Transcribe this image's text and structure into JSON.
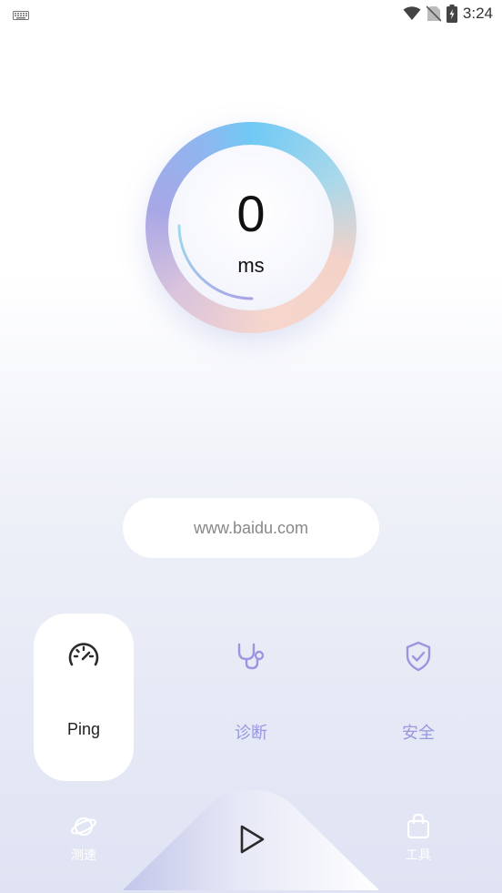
{
  "status_bar": {
    "time": "3:24",
    "icons": [
      "keyboard-icon",
      "wifi-icon",
      "no-sim-icon",
      "battery-charging-icon"
    ]
  },
  "gauge": {
    "value": "0",
    "unit": "ms"
  },
  "url_field": {
    "value": "www.baidu.com"
  },
  "modes": [
    {
      "label": "Ping",
      "icon": "speedometer-icon",
      "active": true
    },
    {
      "label": "诊断",
      "icon": "stethoscope-icon",
      "active": false
    },
    {
      "label": "安全",
      "icon": "shield-check-icon",
      "active": false
    }
  ],
  "bottom_nav": {
    "speed_test": {
      "label": "测速",
      "icon": "planet-icon"
    },
    "start": {
      "icon": "play-icon"
    },
    "tools": {
      "label": "工具",
      "icon": "bag-icon"
    }
  },
  "colors": {
    "accent": "#9a96e0",
    "background_bottom": "#dfe3f3"
  }
}
